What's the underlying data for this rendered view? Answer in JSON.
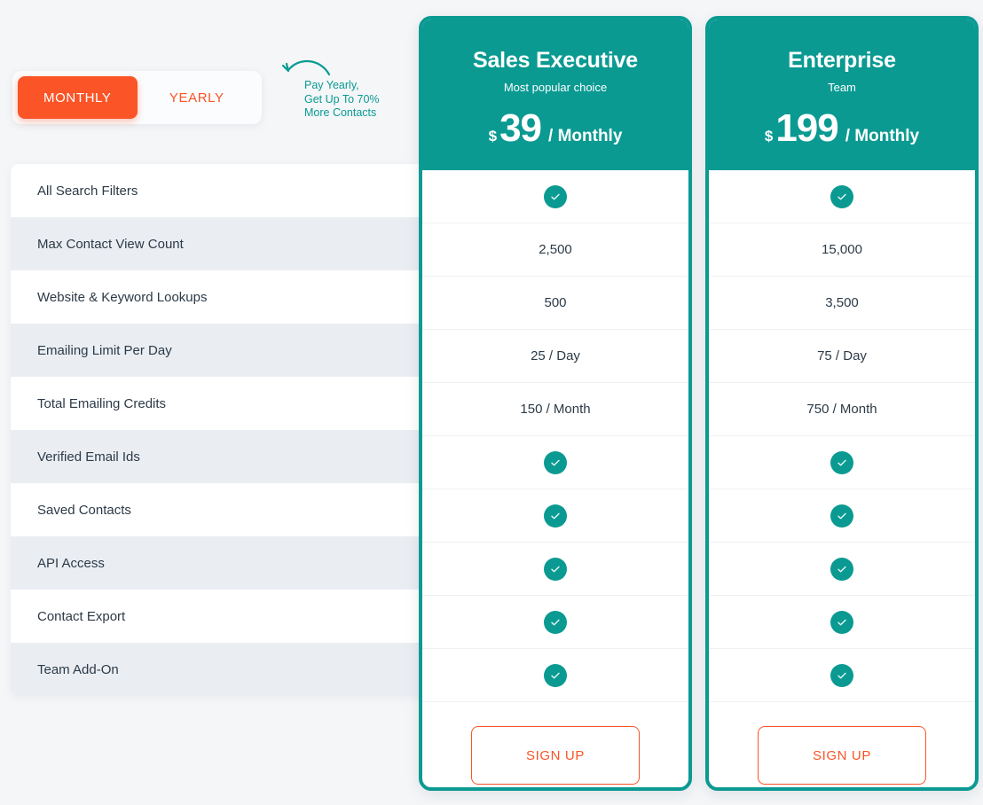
{
  "billing_toggle": {
    "options": [
      {
        "label": "MONTHLY",
        "active": true
      },
      {
        "label": "YEARLY",
        "active": false
      }
    ]
  },
  "promo": {
    "text": "Pay Yearly,\nGet Up To 70%\nMore Contacts",
    "arrow_icon": "curved-arrow-left-icon",
    "color": "#0a9a92"
  },
  "features": [
    "All Search Filters",
    "Max Contact View Count",
    "Website & Keyword Lookups",
    "Emailing Limit Per Day",
    "Total Emailing Credits",
    "Verified Email Ids",
    "Saved Contacts",
    "API Access",
    "Contact Export",
    "Team Add-On"
  ],
  "plans": [
    {
      "name": "Sales Executive",
      "subtitle": "Most popular choice",
      "currency": "$",
      "amount": "39",
      "period": "/ Monthly",
      "cta_label": "SIGN UP",
      "values": [
        {
          "type": "check",
          "text": ""
        },
        {
          "type": "text",
          "text": "2,500"
        },
        {
          "type": "text",
          "text": "500"
        },
        {
          "type": "text",
          "text": "25 / Day"
        },
        {
          "type": "text",
          "text": "150 / Month"
        },
        {
          "type": "check",
          "text": ""
        },
        {
          "type": "check",
          "text": ""
        },
        {
          "type": "check",
          "text": ""
        },
        {
          "type": "check",
          "text": ""
        },
        {
          "type": "check",
          "text": ""
        }
      ]
    },
    {
      "name": "Enterprise",
      "subtitle": "Team",
      "currency": "$",
      "amount": "199",
      "period": "/ Monthly",
      "cta_label": "SIGN UP",
      "values": [
        {
          "type": "check",
          "text": ""
        },
        {
          "type": "text",
          "text": "15,000"
        },
        {
          "type": "text",
          "text": "3,500"
        },
        {
          "type": "text",
          "text": "75 / Day"
        },
        {
          "type": "text",
          "text": "750 / Month"
        },
        {
          "type": "check",
          "text": ""
        },
        {
          "type": "check",
          "text": ""
        },
        {
          "type": "check",
          "text": ""
        },
        {
          "type": "check",
          "text": ""
        },
        {
          "type": "check",
          "text": ""
        }
      ]
    }
  ],
  "colors": {
    "accent_teal": "#0a9a92",
    "accent_orange": "#fa5427",
    "page_bg": "#f4f6f8",
    "row_alt_bg": "#eaeef3",
    "text": "#2c3a47"
  },
  "icons": {
    "check": "check-circle-icon"
  }
}
